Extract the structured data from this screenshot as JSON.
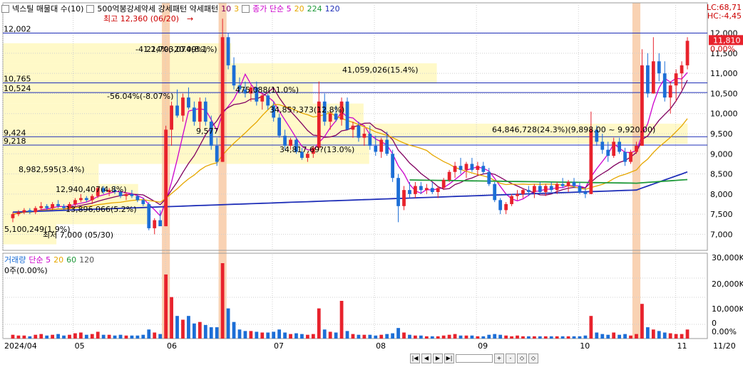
{
  "legend": {
    "title": "넥스틸 매물대 수(10)",
    "subtitle": "500억봉강세약세 강세패턴 약세패턴",
    "ma_label": "종가 단순 5",
    "ma_values": [
      "10",
      "3",
      "5",
      "20",
      "224",
      "120"
    ]
  },
  "volume_legend": {
    "title": "거래량",
    "ma_label": "단순 5",
    "ma_values": [
      "20",
      "60",
      "120"
    ],
    "sub": "0주(0.00%)"
  },
  "corner": {
    "lc": "LC:68,71",
    "hc": "HC:-4,45"
  },
  "toolbar": {
    "buttons": [
      "|◀",
      "◀",
      "▶",
      "▶|",
      "+",
      "-",
      "◇",
      "◇"
    ]
  },
  "colors": {
    "up": "#e8222c",
    "down": "#1c6ed6",
    "ma5": "#cc00cc",
    "ma10": "#800060",
    "ma20": "#e6a700",
    "ma120": "#1f2fb8",
    "ma224": "#1f9a3a",
    "band": "#fff8c2",
    "highlight": "#f7c7a0",
    "hline": "#1f2fb8"
  },
  "chart_data": [
    {
      "type": "candlestick",
      "title": "넥스틸",
      "x_ticks": [
        "2024/04",
        "05",
        "06",
        "07",
        "08",
        "09",
        "10",
        "11",
        "11/20"
      ],
      "ylim": [
        6600,
        12400
      ],
      "y_ticks": [
        7000,
        7500,
        8000,
        8500,
        9000,
        9500,
        10000,
        10500,
        11000,
        11500,
        12000
      ],
      "h_lines": [
        {
          "value": 12002,
          "label": "12,002"
        },
        {
          "value": 10765,
          "label": "10,765"
        },
        {
          "value": 10524,
          "label": "10,524"
        },
        {
          "value": 9424,
          "label": "9,424"
        },
        {
          "value": 9218,
          "label": "9,218"
        }
      ],
      "right_badges": [
        "11,810",
        "0.00%"
      ],
      "annotations": [
        {
          "text": "최고 12,360 (06/20)",
          "x": "06/20",
          "y": 12360
        },
        {
          "text": "최저 7,000 (05/30)",
          "x": "05/30",
          "y": 7000
        },
        {
          "text": "-41.24%(-20.09%)",
          "x": "06/21",
          "y": 11480
        },
        {
          "text": "21,703,074(8.1%)",
          "x": "06/24",
          "y": 11480
        },
        {
          "text": "41,059,026(15.4%)",
          "x": "",
          "y": 11020
        },
        {
          "text": "-56.04%(-8.07%)",
          "x": "05/31",
          "y": 10400
        },
        {
          "text": "475,088(11.0%)",
          "x": "",
          "y": 10550
        },
        {
          "text": "34,85?,373(12.8%)",
          "x": "",
          "y": 10070
        },
        {
          "text": "9,577",
          "x": "06/18",
          "y": 9500
        },
        {
          "text": "64,846,728(24.3%)(9,898.00 ~ 9,920.00)",
          "x": "",
          "y": 9550
        },
        {
          "text": "34,817,69?(13.0%)",
          "x": "",
          "y": 9050
        },
        {
          "text": "8,982,595(3.4%)",
          "x": "",
          "y": 8650
        },
        {
          "text": "12,940,407(4.8%)",
          "x": "",
          "y": 8150
        },
        {
          "text": "13,896,066(5.2%)",
          "x": "",
          "y": 7700
        },
        {
          "text": "5,100,249(1.9%)",
          "x": "",
          "y": 7200
        }
      ],
      "volume_profile": [
        {
          "from": 11250,
          "to": 11750,
          "label": "21,703,074(8.1%)"
        },
        {
          "from": 10750,
          "to": 11250,
          "label": "41,059,026(15.4%)"
        },
        {
          "from": 10250,
          "to": 10750,
          "label": "475,088(11.0%)"
        },
        {
          "from": 9750,
          "to": 10250,
          "label": "34,85?,373(12.8%)"
        },
        {
          "from": 9250,
          "to": 9750,
          "label": "64,846,728(24.3%)"
        },
        {
          "from": 8750,
          "to": 9250,
          "label": "34,817,69?(13.0%)"
        },
        {
          "from": 8250,
          "to": 8750,
          "label": "8,982,595(3.4%)"
        },
        {
          "from": 7750,
          "to": 8250,
          "label": "12,940,407(4.8%)"
        },
        {
          "from": 7250,
          "to": 7750,
          "label": "13,896,066(5.2%)"
        },
        {
          "from": 6750,
          "to": 7250,
          "label": "5,100,249(1.9%)"
        }
      ],
      "series_ohlc": [
        [
          7400,
          7550,
          7300,
          7500
        ],
        [
          7500,
          7600,
          7450,
          7550
        ],
        [
          7550,
          7650,
          7500,
          7600
        ],
        [
          7600,
          7650,
          7500,
          7550
        ],
        [
          7550,
          7700,
          7500,
          7650
        ],
        [
          7650,
          7800,
          7600,
          7700
        ],
        [
          7700,
          7750,
          7600,
          7650
        ],
        [
          7650,
          7800,
          7600,
          7750
        ],
        [
          7750,
          7850,
          7650,
          7700
        ],
        [
          7700,
          7750,
          7600,
          7650
        ],
        [
          7650,
          7800,
          7600,
          7750
        ],
        [
          7750,
          7900,
          7700,
          7850
        ],
        [
          7850,
          8000,
          7800,
          7900
        ],
        [
          7900,
          7950,
          7800,
          7850
        ],
        [
          7850,
          8000,
          7750,
          7950
        ],
        [
          7950,
          8200,
          7900,
          8150
        ],
        [
          8150,
          8200,
          8000,
          8050
        ],
        [
          8050,
          8150,
          7950,
          8100
        ],
        [
          8100,
          8200,
          8000,
          8050
        ],
        [
          8050,
          8100,
          7900,
          7950
        ],
        [
          7950,
          8050,
          7850,
          8000
        ],
        [
          8000,
          8100,
          7900,
          7950
        ],
        [
          7950,
          8000,
          7800,
          7850
        ],
        [
          7850,
          7900,
          7700,
          7750
        ],
        [
          7750,
          7800,
          7100,
          7150
        ],
        [
          7150,
          7400,
          7000,
          7350
        ],
        [
          7350,
          7600,
          7250,
          7200
        ],
        [
          7200,
          9700,
          7200,
          9600
        ],
        [
          9600,
          10300,
          9200,
          10200
        ],
        [
          10200,
          10600,
          9900,
          9950
        ],
        [
          9950,
          10500,
          9800,
          10400
        ],
        [
          10400,
          10650,
          10100,
          10150
        ],
        [
          10150,
          10300,
          9700,
          9800
        ],
        [
          9800,
          10400,
          9600,
          10300
        ],
        [
          10300,
          10400,
          9700,
          9800
        ],
        [
          9800,
          9950,
          9100,
          9200
        ],
        [
          9200,
          9400,
          8700,
          8800
        ],
        [
          8800,
          12360,
          8800,
          11900
        ],
        [
          11900,
          12000,
          11100,
          11200
        ],
        [
          11200,
          11400,
          10600,
          10700
        ],
        [
          10700,
          10900,
          10500,
          10600
        ],
        [
          10600,
          10800,
          10400,
          10500
        ],
        [
          10500,
          10700,
          10300,
          10650
        ],
        [
          10650,
          10800,
          10200,
          10300
        ],
        [
          10300,
          10500,
          10100,
          10450
        ],
        [
          10450,
          10500,
          10100,
          10200
        ],
        [
          10200,
          10300,
          9800,
          9900
        ],
        [
          9900,
          10000,
          9400,
          9450
        ],
        [
          9450,
          9600,
          9100,
          9200
        ],
        [
          9200,
          9400,
          9100,
          9350
        ],
        [
          9350,
          9400,
          9000,
          9050
        ],
        [
          9050,
          9150,
          8850,
          8900
        ],
        [
          8900,
          9050,
          8800,
          9000
        ],
        [
          9000,
          9200,
          8900,
          9150
        ],
        [
          9150,
          10800,
          9100,
          10300
        ],
        [
          10300,
          10500,
          9700,
          9800
        ],
        [
          9800,
          10100,
          9600,
          10000
        ],
        [
          10000,
          10200,
          9800,
          9850
        ],
        [
          9850,
          10400,
          9700,
          10300
        ],
        [
          10300,
          10400,
          9700,
          9600
        ],
        [
          9600,
          9800,
          9400,
          9700
        ],
        [
          9700,
          9800,
          9300,
          9400
        ],
        [
          9400,
          9650,
          9200,
          9500
        ],
        [
          9500,
          9700,
          9100,
          9200
        ],
        [
          9200,
          9450,
          8950,
          9050
        ],
        [
          9050,
          9400,
          8900,
          9350
        ],
        [
          9350,
          9550,
          8950,
          9000
        ],
        [
          9000,
          9100,
          8300,
          8400
        ],
        [
          8400,
          8500,
          7300,
          7700
        ],
        [
          7700,
          8200,
          7600,
          8100
        ],
        [
          8100,
          8300,
          7900,
          8000
        ],
        [
          8000,
          8300,
          7900,
          8200
        ],
        [
          8200,
          8300,
          8000,
          8100
        ],
        [
          8100,
          8250,
          8000,
          8150
        ],
        [
          8150,
          8300,
          8000,
          8050
        ],
        [
          8050,
          8200,
          7900,
          8150
        ],
        [
          8150,
          8400,
          8100,
          8350
        ],
        [
          8350,
          8600,
          8300,
          8550
        ],
        [
          8550,
          8800,
          8400,
          8700
        ],
        [
          8700,
          8900,
          8500,
          8600
        ],
        [
          8600,
          8800,
          8400,
          8750
        ],
        [
          8750,
          8900,
          8550,
          8600
        ],
        [
          8600,
          8800,
          8450,
          8700
        ],
        [
          8700,
          8800,
          8500,
          8550
        ],
        [
          8550,
          8650,
          8200,
          8250
        ],
        [
          8250,
          8300,
          7800,
          7850
        ],
        [
          7850,
          7900,
          7500,
          7600
        ],
        [
          7600,
          7800,
          7500,
          7750
        ],
        [
          7750,
          8000,
          7700,
          7950
        ],
        [
          7950,
          8100,
          7850,
          8000
        ],
        [
          8000,
          8150,
          7900,
          8100
        ],
        [
          8100,
          8200,
          7950,
          8050
        ],
        [
          8050,
          8250,
          7900,
          8200
        ],
        [
          8200,
          8300,
          8000,
          8050
        ],
        [
          8050,
          8250,
          7950,
          8200
        ],
        [
          8200,
          8300,
          8050,
          8100
        ],
        [
          8100,
          8300,
          8000,
          8250
        ],
        [
          8250,
          8400,
          8150,
          8200
        ],
        [
          8200,
          8350,
          8050,
          8300
        ],
        [
          8300,
          8400,
          8150,
          8200
        ],
        [
          8200,
          8300,
          8000,
          8050
        ],
        [
          8050,
          8150,
          7900,
          8000
        ],
        [
          8000,
          10050,
          8000,
          9600
        ],
        [
          9600,
          9700,
          9200,
          9300
        ],
        [
          9300,
          9500,
          9000,
          9100
        ],
        [
          9100,
          9300,
          8800,
          8950
        ],
        [
          8950,
          9400,
          8900,
          9300
        ],
        [
          9300,
          9400,
          9000,
          9050
        ],
        [
          9050,
          9150,
          8700,
          8800
        ],
        [
          8800,
          9100,
          8750,
          9050
        ],
        [
          9050,
          9300,
          9000,
          9200
        ],
        [
          9200,
          11600,
          9200,
          11200
        ],
        [
          11200,
          11500,
          10400,
          10500
        ],
        [
          10500,
          11900,
          10500,
          11300
        ],
        [
          11300,
          11500,
          10800,
          11000
        ],
        [
          11000,
          11300,
          10300,
          10400
        ],
        [
          10400,
          10800,
          10000,
          10700
        ],
        [
          10700,
          11100,
          10300,
          11000
        ],
        [
          11000,
          11300,
          10600,
          11200
        ],
        [
          11200,
          11900,
          11100,
          11810
        ]
      ],
      "series_volume": [
        0.05,
        0.04,
        0.04,
        0.03,
        0.05,
        0.06,
        0.04,
        0.05,
        0.06,
        0.04,
        0.05,
        0.07,
        0.08,
        0.05,
        0.06,
        0.09,
        0.05,
        0.05,
        0.04,
        0.05,
        0.04,
        0.04,
        0.04,
        0.05,
        0.12,
        0.08,
        0.06,
        0.85,
        0.55,
        0.3,
        0.25,
        0.3,
        0.2,
        0.22,
        0.18,
        0.15,
        0.15,
        1.0,
        0.4,
        0.22,
        0.12,
        0.1,
        0.1,
        0.09,
        0.08,
        0.08,
        0.09,
        0.12,
        0.08,
        0.06,
        0.07,
        0.06,
        0.05,
        0.06,
        0.4,
        0.12,
        0.09,
        0.08,
        0.5,
        0.1,
        0.06,
        0.05,
        0.05,
        0.05,
        0.04,
        0.05,
        0.06,
        0.07,
        0.14,
        0.08,
        0.05,
        0.04,
        0.04,
        0.03,
        0.03,
        0.03,
        0.04,
        0.05,
        0.06,
        0.04,
        0.04,
        0.04,
        0.03,
        0.03,
        0.05,
        0.06,
        0.05,
        0.04,
        0.03,
        0.04,
        0.03,
        0.03,
        0.03,
        0.03,
        0.03,
        0.03,
        0.03,
        0.03,
        0.03,
        0.03,
        0.03,
        0.04,
        0.3,
        0.08,
        0.06,
        0.05,
        0.08,
        0.05,
        0.06,
        0.04,
        0.06,
        0.46,
        0.15,
        0.12,
        0.1,
        0.08,
        0.07,
        0.06,
        0.06,
        0.12
      ],
      "highlight_days": [
        27,
        37,
        110
      ],
      "volume_axis": [
        "30,000K",
        "20,000K",
        "10,000K",
        "0",
        "0.00%"
      ]
    }
  ]
}
